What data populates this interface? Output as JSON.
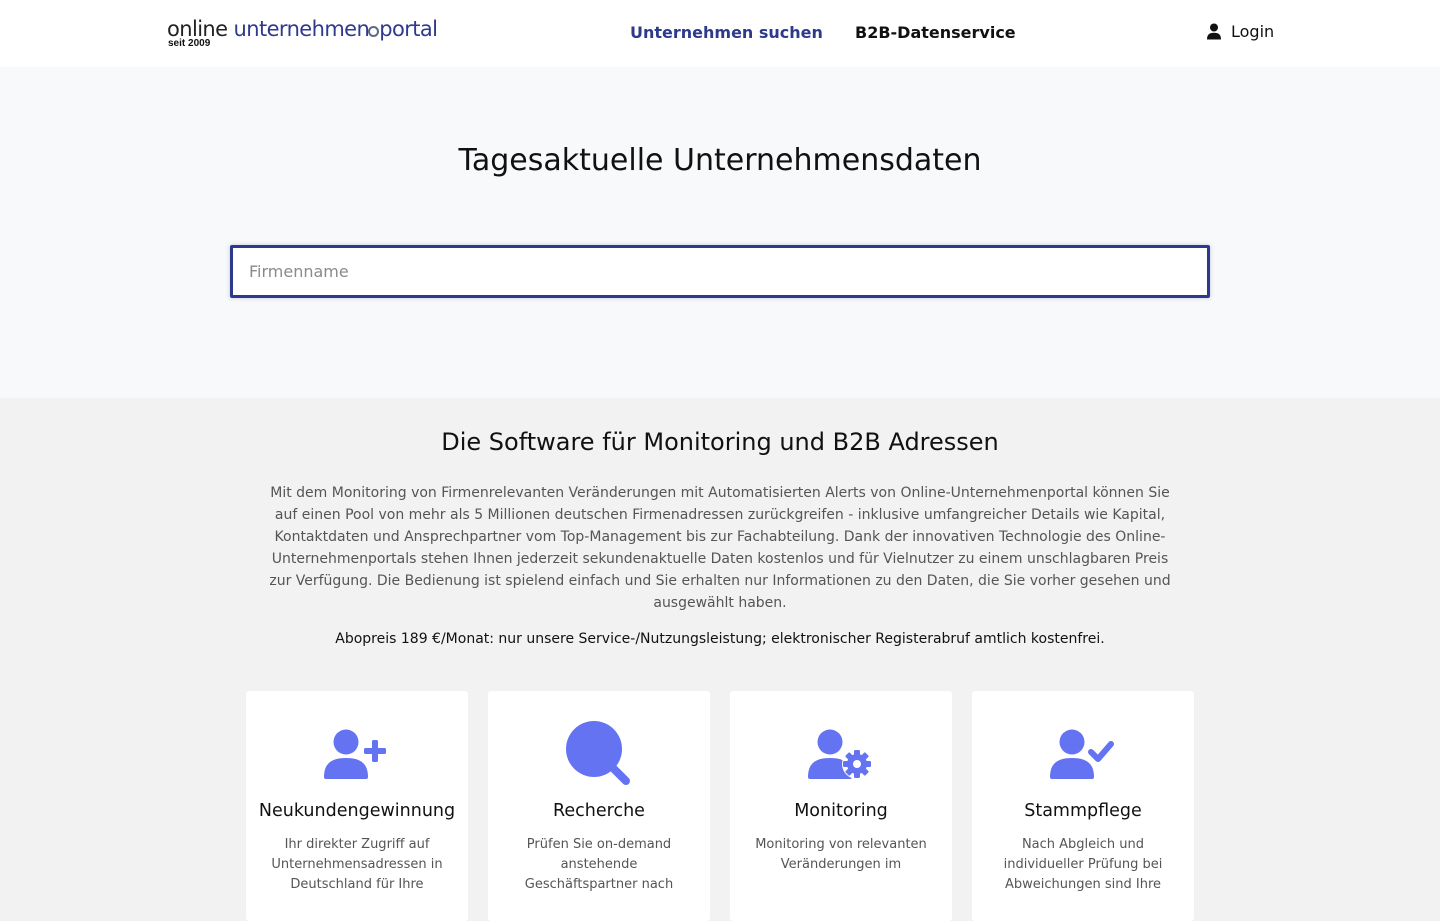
{
  "header": {
    "logo": {
      "part1": "online ",
      "part2a": "unternehmen",
      "part2b": "portal",
      "since": "seit 2009"
    },
    "nav": {
      "search": "Unternehmen suchen",
      "b2b": "B2B-Datenservice"
    },
    "login_label": "Login"
  },
  "hero": {
    "title": "Tagesaktuelle Unternehmensdaten",
    "search_placeholder": "Firmenname",
    "search_value": ""
  },
  "section": {
    "title": "Die Software für Monitoring und B2B Adressen",
    "body": "Mit dem Monitoring von Firmenrelevanten Veränderungen mit Automatisierten Alerts von Online-Unternehmenportal können Sie auf einen Pool von mehr als 5 Millionen deutschen Firmenadressen zurückgreifen - inklusive umfangreicher Details wie Kapital, Kontaktdaten und Ansprechpartner vom Top-Management bis zur Fachabteilung. Dank der innovativen Technologie des Online-Unternehmenportals stehen Ihnen jederzeit sekundenaktuelle Daten kostenlos und für Vielnutzer zu einem unschlagbaren Preis zur Verfügung. Die Bedienung ist spielend einfach und Sie erhalten nur Informationen zu den Daten, die Sie vorher gesehen und ausgewählt haben.",
    "price": "Abopreis 189 €/Monat: nur unsere Service-/Nutzungsleistung; elektronischer Registerabruf amtlich kostenfrei."
  },
  "cards": [
    {
      "icon": "user-plus-icon",
      "title": "Neukundengewinnung",
      "text": "Ihr direkter Zugriff auf Unternehmensadressen in Deutschland für Ihre"
    },
    {
      "icon": "search-icon",
      "title": "Recherche",
      "text": "Prüfen Sie on-demand anstehende Geschäftspartner nach"
    },
    {
      "icon": "user-gear-icon",
      "title": "Monitoring",
      "text": "Monitoring von relevanten Veränderungen im"
    },
    {
      "icon": "user-check-icon",
      "title": "Stammpflege",
      "text": "Nach Abgleich und individueller Prüfung bei Abweichungen sind Ihre"
    }
  ],
  "colors": {
    "brand": "#2d3a8c",
    "icon": "#6473f2",
    "hero_bg": "#f8f9fb",
    "page_bg": "#f2f2f2"
  }
}
